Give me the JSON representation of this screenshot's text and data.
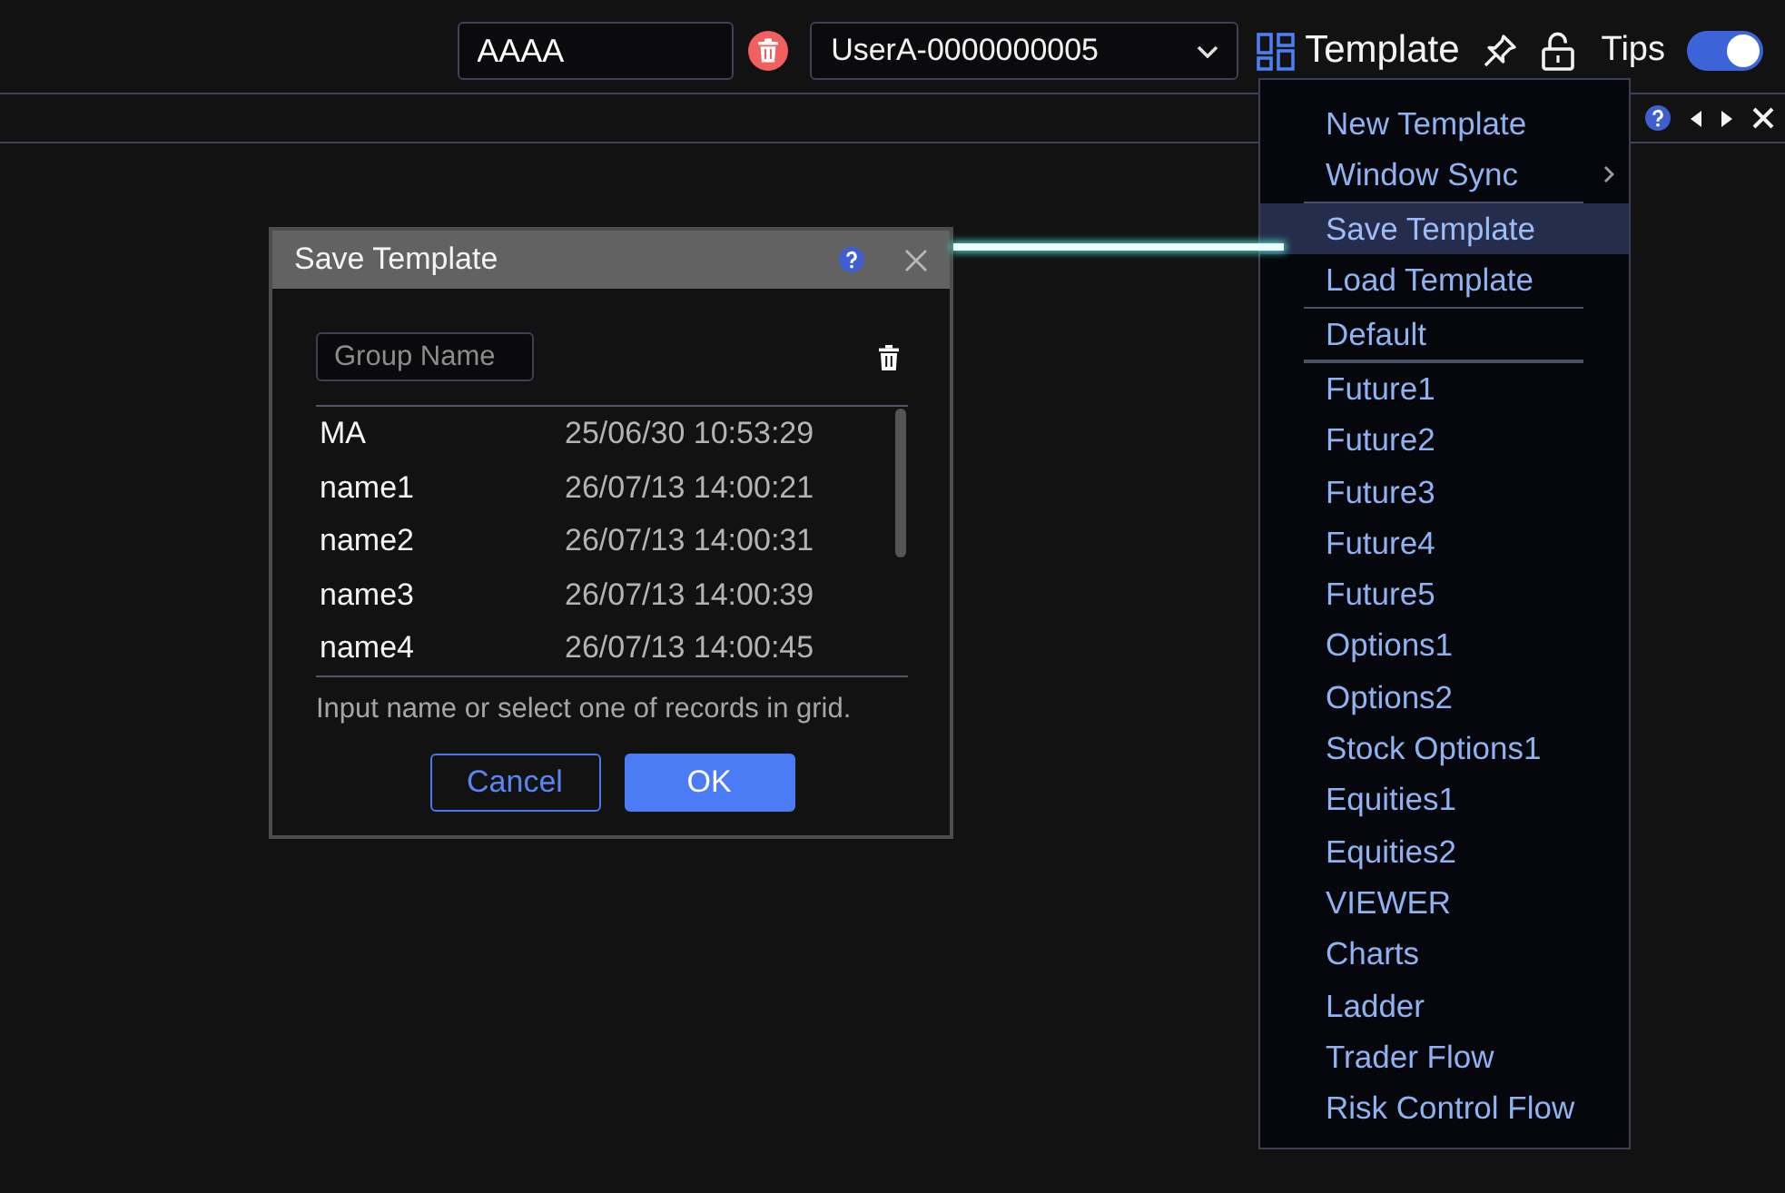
{
  "toolbar": {
    "name_field": {
      "value": "AAAA"
    },
    "user_select": {
      "value": "UserA-0000000005"
    },
    "template_button": {
      "label": "Template"
    },
    "tips": {
      "label": "Tips",
      "on": true
    }
  },
  "dialog": {
    "title": "Save Template",
    "group_name": {
      "placeholder": "Group Name"
    },
    "records": [
      {
        "name": "MA",
        "time": "25/06/30 10:53:29"
      },
      {
        "name": "name1",
        "time": "26/07/13 14:00:21"
      },
      {
        "name": "name2",
        "time": "26/07/13 14:00:31"
      },
      {
        "name": "name3",
        "time": "26/07/13 14:00:39"
      },
      {
        "name": "name4",
        "time": "26/07/13 14:00:45"
      }
    ],
    "hint": "Input name or select one of records in grid.",
    "buttons": [
      {
        "label": "Cancel",
        "kind": "secondary"
      },
      {
        "label": "OK",
        "kind": "primary"
      }
    ]
  },
  "menu": {
    "items": [
      {
        "label": "New Template",
        "selected": false,
        "submenu": false,
        "separator_after": false
      },
      {
        "label": "Window Sync",
        "selected": false,
        "submenu": true,
        "separator_after": true
      },
      {
        "label": "Save Template",
        "selected": true,
        "submenu": false,
        "separator_after": false
      },
      {
        "label": "Load Template",
        "selected": false,
        "submenu": false,
        "separator_after": true
      },
      {
        "label": "Default",
        "selected": false,
        "submenu": false,
        "separator_after": true
      },
      {
        "label": "Future1",
        "selected": false,
        "submenu": false,
        "separator_after": false
      },
      {
        "label": "Future2",
        "selected": false,
        "submenu": false,
        "separator_after": false
      },
      {
        "label": "Future3",
        "selected": false,
        "submenu": false,
        "separator_after": false
      },
      {
        "label": "Future4",
        "selected": false,
        "submenu": false,
        "separator_after": false
      },
      {
        "label": "Future5",
        "selected": false,
        "submenu": false,
        "separator_after": false
      },
      {
        "label": "Options1",
        "selected": false,
        "submenu": false,
        "separator_after": false
      },
      {
        "label": "Options2",
        "selected": false,
        "submenu": false,
        "separator_after": false
      },
      {
        "label": "Stock Options1",
        "selected": false,
        "submenu": false,
        "separator_after": false
      },
      {
        "label": "Equities1",
        "selected": false,
        "submenu": false,
        "separator_after": false
      },
      {
        "label": "Equities2",
        "selected": false,
        "submenu": false,
        "separator_after": false
      },
      {
        "label": "VIEWER",
        "selected": false,
        "submenu": false,
        "separator_after": false
      },
      {
        "label": "Charts",
        "selected": false,
        "submenu": false,
        "separator_after": false
      },
      {
        "label": "Ladder",
        "selected": false,
        "submenu": false,
        "separator_after": false
      },
      {
        "label": "Trader Flow",
        "selected": false,
        "submenu": false,
        "separator_after": false
      },
      {
        "label": "Risk Control Flow",
        "selected": false,
        "submenu": false,
        "separator_after": false
      }
    ]
  }
}
